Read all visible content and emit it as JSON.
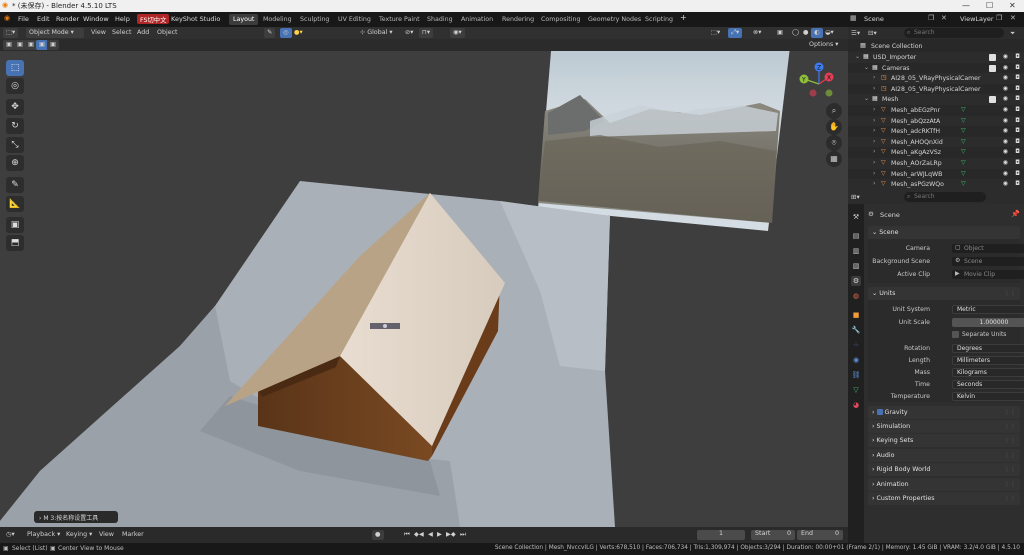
{
  "window": {
    "title": "* (未保存) - Blender 4.5.10 LTS",
    "minimize": "—",
    "maximize": "☐",
    "close": "✕"
  },
  "menu": [
    "File",
    "Edit",
    "Render",
    "Window",
    "Help"
  ],
  "plugin_tabs": {
    "fs": "FS切中文",
    "keyshot": "KeyShot Studio"
  },
  "workspaces": [
    "Layout",
    "Modeling",
    "Sculpting",
    "UV Editing",
    "Texture Paint",
    "Shading",
    "Animation",
    "Rendering",
    "Compositing",
    "Geometry Nodes",
    "Scripting"
  ],
  "workspace_add": "+",
  "scene": {
    "label": "Scene",
    "view_layer": "ViewLayer"
  },
  "viewport_header": {
    "mode": "Object Mode",
    "view": "View",
    "select": "Select",
    "add": "Add",
    "object": "Object",
    "orientation": "Global",
    "options": "Options"
  },
  "operator_panel": "M 3:按名称设置工具",
  "gizmo_axes": {
    "x": "X",
    "y": "Y",
    "z": "Z"
  },
  "outliner": {
    "search_placeholder": "Search",
    "title": "Scene Collection",
    "rows": [
      {
        "name": "USD_Importer",
        "indent": 1
      },
      {
        "name": "Cameras",
        "indent": 2
      },
      {
        "name": "AI28_05_VRayPhysicalCamer",
        "indent": 3
      },
      {
        "name": "AI28_05_VRayPhysicalCamer",
        "indent": 3
      },
      {
        "name": "Mesh",
        "indent": 2
      },
      {
        "name": "Mesh_abEGzPnr",
        "indent": 3
      },
      {
        "name": "Mesh_abQzzAtA",
        "indent": 3
      },
      {
        "name": "Mesh_adcRKTfH",
        "indent": 3
      },
      {
        "name": "Mesh_AHOQnXid",
        "indent": 3
      },
      {
        "name": "Mesh_aKgAzVSz",
        "indent": 3
      },
      {
        "name": "Mesh_AOrZaLRp",
        "indent": 3
      },
      {
        "name": "Mesh_arWJLqWB",
        "indent": 3
      },
      {
        "name": "Mesh_asPGzWQo",
        "indent": 3
      }
    ]
  },
  "properties": {
    "search_placeholder": "Search",
    "context": "Scene",
    "scene_panel": {
      "title": "Scene",
      "camera_label": "Camera",
      "camera_placeholder": "Object",
      "bg_label": "Background Scene",
      "bg_placeholder": "Scene",
      "clip_label": "Active Clip",
      "clip_placeholder": "Movie Clip"
    },
    "units_panel": {
      "title": "Units",
      "unit_system_label": "Unit System",
      "unit_system": "Metric",
      "unit_scale_label": "Unit Scale",
      "unit_scale": "1.000000",
      "separate_units": "Separate Units",
      "rotation_label": "Rotation",
      "rotation": "Degrees",
      "length_label": "Length",
      "length": "Millimeters",
      "mass_label": "Mass",
      "mass": "Kilograms",
      "time_label": "Time",
      "time": "Seconds",
      "temperature_label": "Temperature",
      "temperature": "Kelvin"
    },
    "collapsed_panels": [
      "Gravity",
      "Simulation",
      "Keying Sets",
      "Audio",
      "Rigid Body World",
      "Animation",
      "Custom Properties"
    ]
  },
  "timeline": {
    "playback": "Playback",
    "keying": "Keying",
    "view": "View",
    "marker": "Marker",
    "current_frame": "1",
    "start_label": "Start",
    "start": "0",
    "end_label": "End",
    "end": "0"
  },
  "status": {
    "left1": "Select (List)",
    "left2": "Center View to Mouse",
    "right": "Scene Collection | Mesh_NvccvILG | Verts:678,510 | Faces:706,734 | Tris:1,309,974 | Objects:3/294 | Duration: 00:00+01 (Frame 2/1) | Memory: 1.45 GiB | VRAM: 3.2/4.0 GiB | 4.5.10"
  }
}
